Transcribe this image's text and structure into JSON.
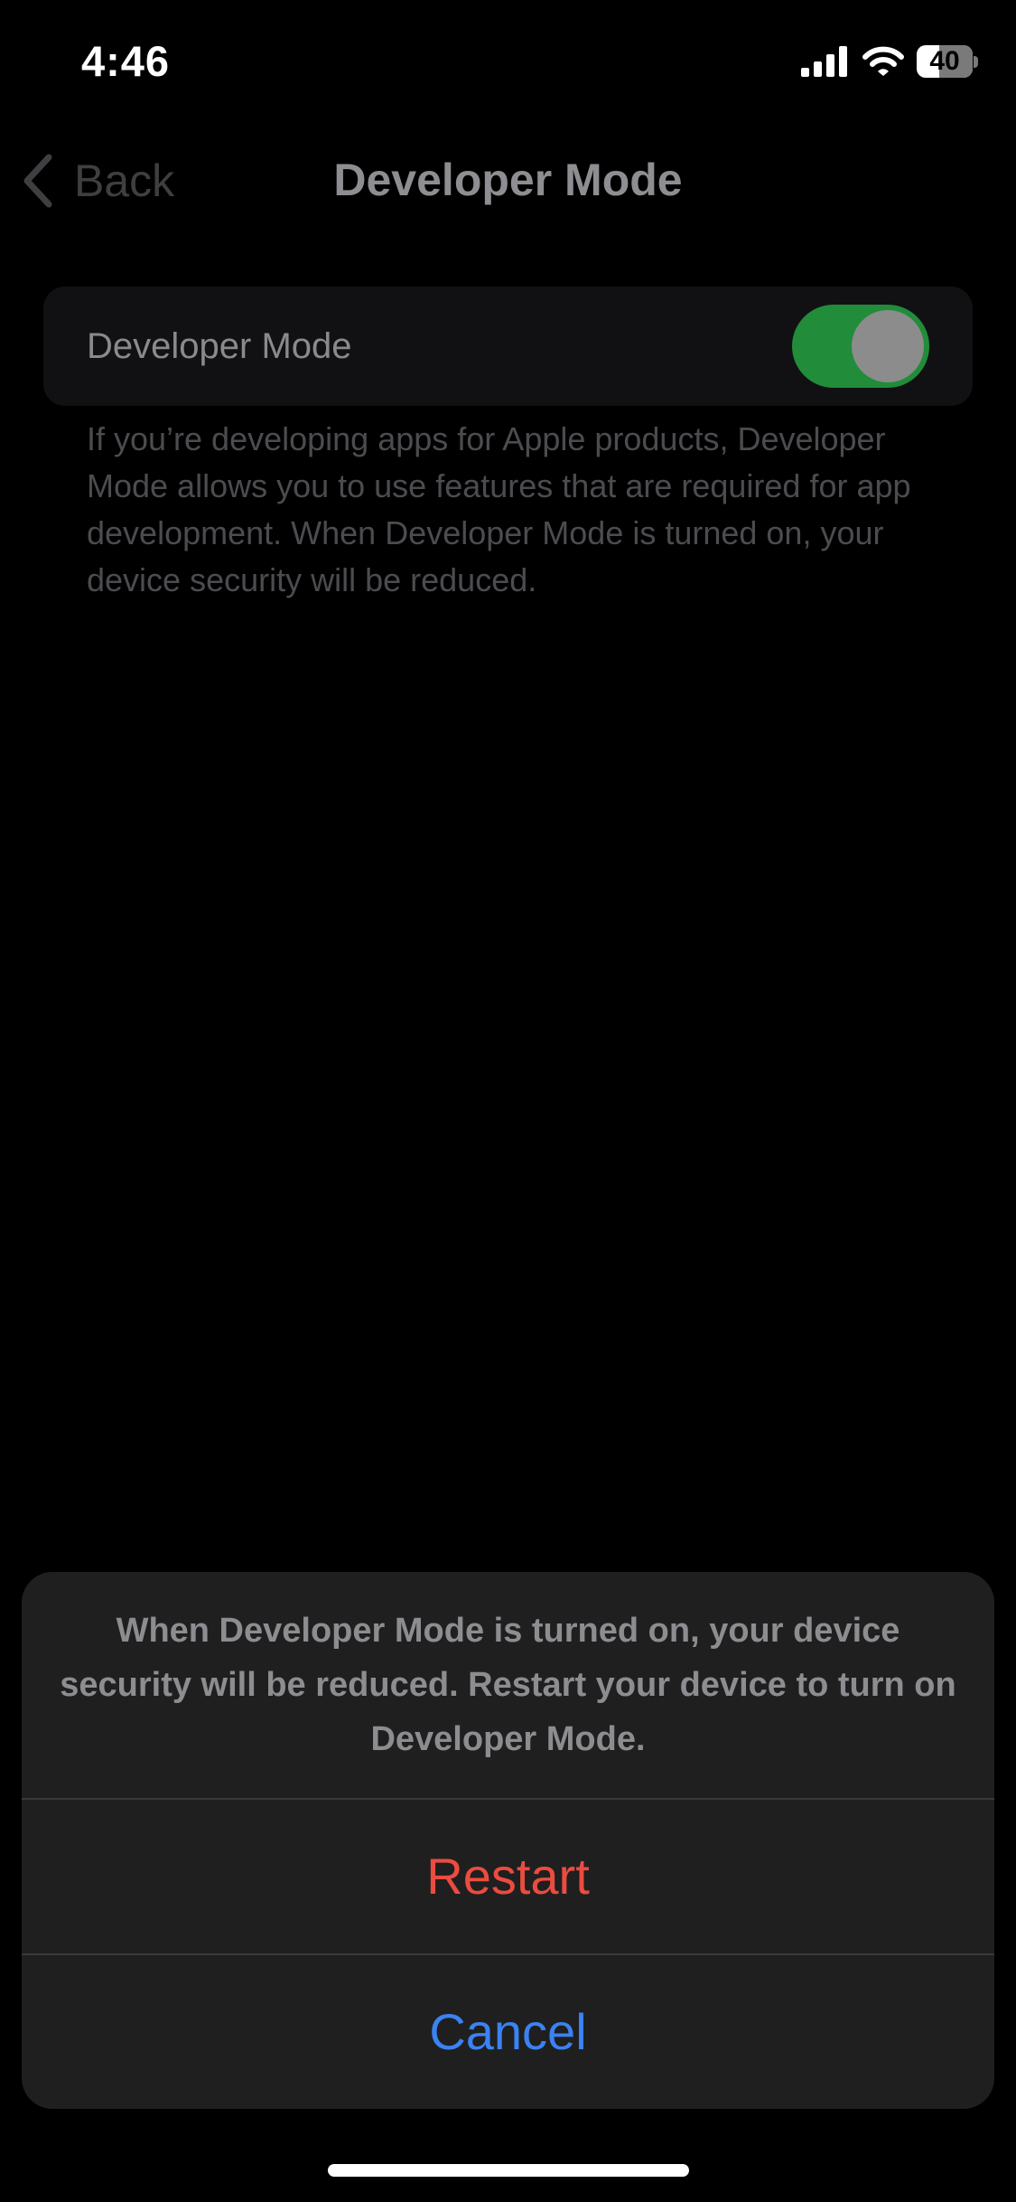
{
  "status_bar": {
    "time": "4:46",
    "battery_percent": "40",
    "battery_level": 0.4,
    "icons": [
      "signal-icon",
      "wifi-icon",
      "battery-icon"
    ]
  },
  "nav": {
    "back_label": "Back",
    "title": "Developer Mode"
  },
  "settings": {
    "row_label": "Developer Mode",
    "toggle_on": true,
    "footer": "If you’re developing apps for Apple products, Developer Mode allows you to use features that are required for app development. When Developer Mode is turned on, your device security will be reduced."
  },
  "action_sheet": {
    "message": "When Developer Mode is turned on, your device security will be reduced. Restart your device to turn on Developer Mode.",
    "restart_label": "Restart",
    "cancel_label": "Cancel"
  },
  "colors": {
    "toggle_on": "#218c3a",
    "destructive": "#eb4c40",
    "accent": "#3b82f2",
    "sheet_background": "#1f1f1f"
  }
}
